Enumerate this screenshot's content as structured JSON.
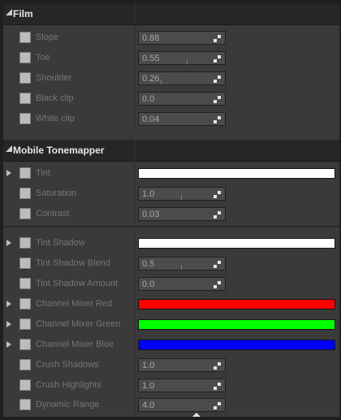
{
  "sections": {
    "film": {
      "title": "Film"
    },
    "mobile": {
      "title": "Mobile Tonemapper"
    }
  },
  "film_rows": [
    {
      "label": "Slope",
      "value": "0.88"
    },
    {
      "label": "Toe",
      "value": "0.55"
    },
    {
      "label": "Shoulder",
      "value": "0.26"
    },
    {
      "label": "Black clip",
      "value": "0.0"
    },
    {
      "label": "White clip",
      "value": "0.04"
    }
  ],
  "mobile_rows": [
    {
      "label": "Tint",
      "color": "#ffffff"
    },
    {
      "label": "Saturation",
      "value": "1.0"
    },
    {
      "label": "Contrast",
      "value": "0.03"
    },
    {
      "label": "Tint Shadow",
      "color": "#ffffff"
    },
    {
      "label": "Tint Shadow Blend",
      "value": "0.5"
    },
    {
      "label": "Tint Shadow Amount",
      "value": "0.0"
    },
    {
      "label": "Channel Mixer Red",
      "color": "#ff0000"
    },
    {
      "label": "Channel Mixer Green",
      "color": "#00ff00"
    },
    {
      "label": "Channel Mixer Blue",
      "color": "#0000ff"
    },
    {
      "label": "Crush Shadows",
      "value": "1.0"
    },
    {
      "label": "Crush Highlights",
      "value": "1.0"
    },
    {
      "label": "Dynamic Range",
      "value": "4.0"
    }
  ]
}
